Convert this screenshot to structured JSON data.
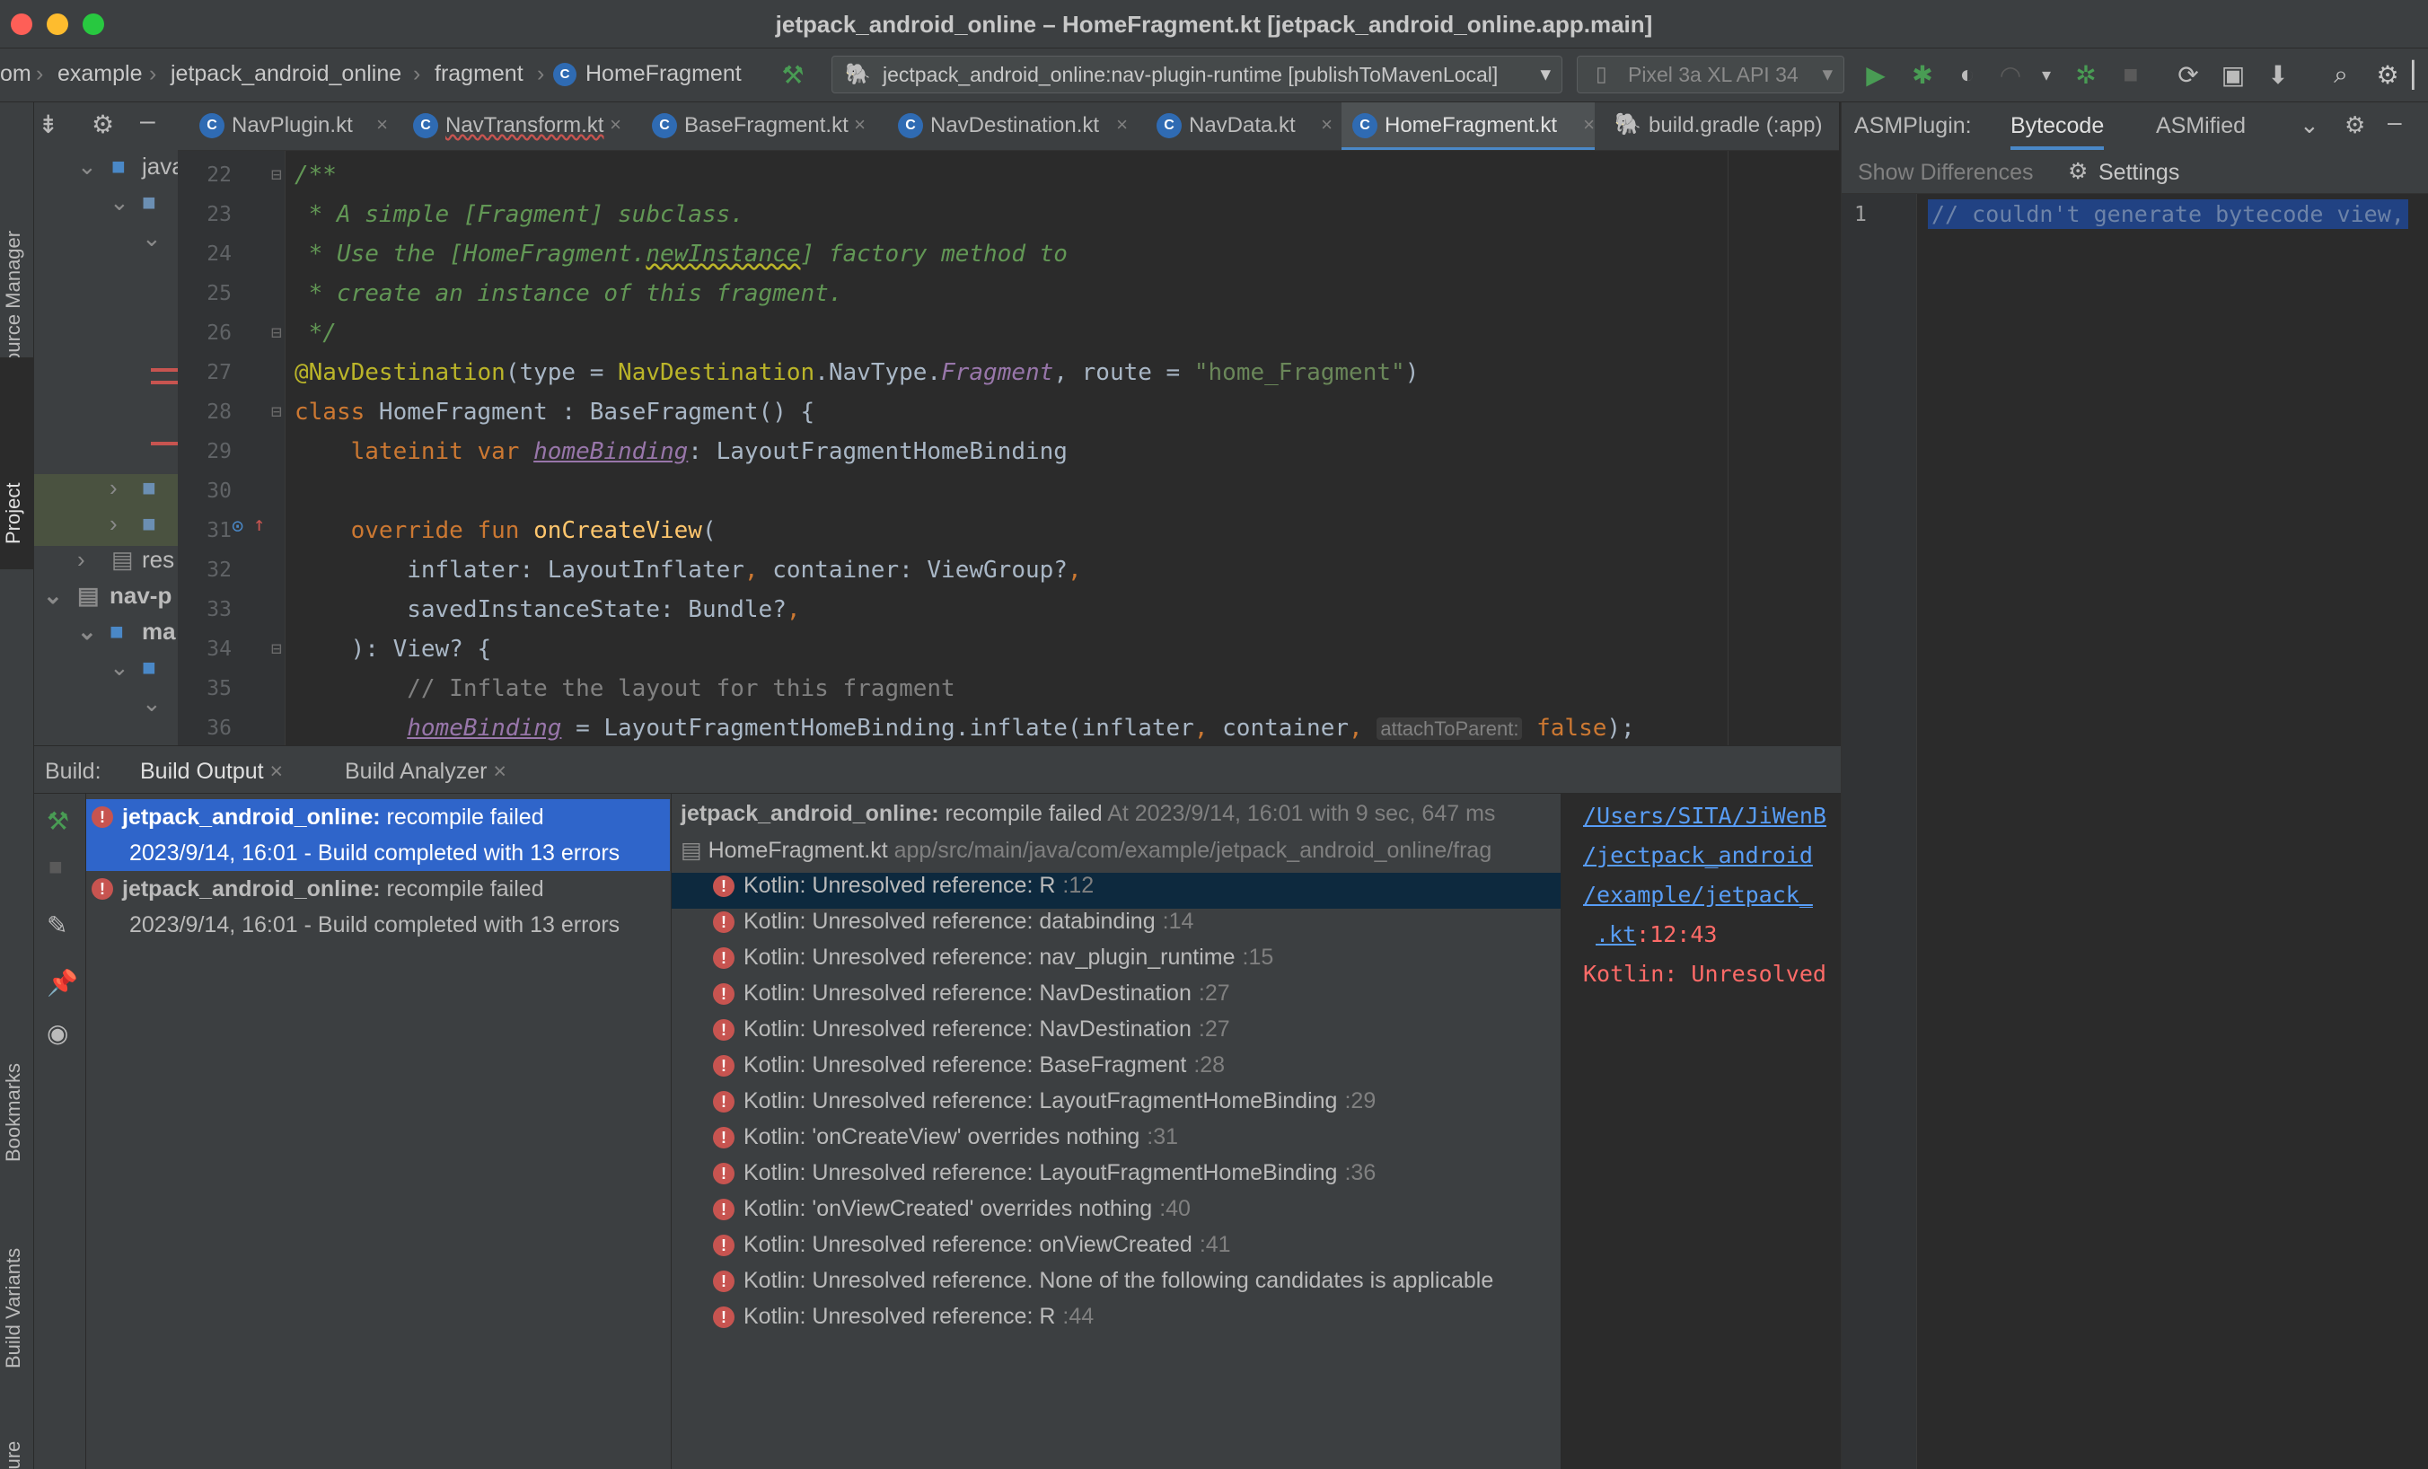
{
  "window": {
    "title": "jetpack_android_online – HomeFragment.kt [jetpack_android_online.app.main]"
  },
  "breadcrumb": [
    "om",
    "example",
    "jetpack_android_online",
    "fragment",
    "HomeFragment"
  ],
  "toolbar": {
    "run_config": "jectpack_android_online:nav-plugin-runtime [publishToMavenLocal]",
    "device": "Pixel 3a XL API 34"
  },
  "left_stripe": {
    "resource_manager": "Resource Manager",
    "project": "Project",
    "bookmarks": "Bookmarks",
    "build_variants": "Build Variants",
    "structure": "Structure"
  },
  "project_tree": [
    {
      "label": "java"
    },
    {
      "label": "res"
    },
    {
      "label": "nav-p"
    },
    {
      "label": "ma"
    }
  ],
  "editor_tabs": [
    {
      "label": "NavPlugin.kt",
      "active": false
    },
    {
      "label": "NavTransform.kt",
      "active": false
    },
    {
      "label": "BaseFragment.kt",
      "active": false
    },
    {
      "label": "NavDestination.kt",
      "active": false
    },
    {
      "label": "NavData.kt",
      "active": false
    },
    {
      "label": "HomeFragment.kt",
      "active": true
    },
    {
      "label": "build.gradle (:app)",
      "active": false
    }
  ],
  "line_numbers": [
    "22",
    "23",
    "24",
    "25",
    "26",
    "27",
    "28",
    "29",
    "30",
    "31",
    "32",
    "33",
    "34",
    "35",
    "36"
  ],
  "code": {
    "l22": "/**",
    "l23": " * A simple [Fragment] subclass.",
    "l24a": " * Use the [HomeFragment.",
    "l24b": "newInstance",
    "l24c": "] factory method to",
    "l25": " * create an instance of this fragment.",
    "l26": " */",
    "l27a": "@NavDestination",
    "l27b": "(type = ",
    "l27c": "NavDestination",
    "l27d": ".NavType.",
    "l27e": "Fragment",
    "l27f": ", route = ",
    "l27g": "\"home_Fragment\"",
    "l27h": ")",
    "l28a": "class",
    "l28b": " HomeFragment : BaseFragment() {",
    "l29a": "    lateinit var ",
    "l29b": "homeBinding",
    "l29c": ": LayoutFragmentHomeBinding",
    "l31a": "    override fun ",
    "l31b": "onCreateView",
    "l31c": "(",
    "l32a": "        inflater: LayoutInflater",
    "l32b": ", ",
    "l32c": "container: ViewGroup?",
    "l32d": ",",
    "l33a": "        savedInstanceState: Bundle?",
    "l33b": ",",
    "l34": "    ): View? {",
    "l35": "        // Inflate the layout for this fragment",
    "l36a": "        ",
    "l36b": "homeBinding",
    "l36c": " = LayoutFragmentHomeBinding.inflate(inflater",
    "l36d": ", ",
    "l36e": "container",
    "l36f": ",",
    "l36hint": "attachToParent:",
    "l36g": "false",
    "l36h": ");"
  },
  "asm": {
    "plugin_label": "ASMPlugin:",
    "tab_bytecode": "Bytecode",
    "tab_asmified": "ASMified",
    "show_differences": "Show Differences",
    "settings": "Settings",
    "line1": "1",
    "line1_text": "// couldn't generate bytecode view,"
  },
  "build": {
    "label": "Build:",
    "tab_output": "Build Output",
    "tab_analyzer": "Build Analyzer",
    "runs": [
      {
        "title": "jetpack_android_online:",
        "status": "recompile failed",
        "detail": "2023/9/14, 16:01 - Build completed with 13 errors",
        "selected": true
      },
      {
        "title": "jetpack_android_online:",
        "status": "recompile failed",
        "detail": "2023/9/14, 16:01 - Build completed with 13 errors",
        "selected": false
      }
    ],
    "tree_header": {
      "title": "jetpack_android_online:",
      "status": "recompile failed",
      "meta": "At 2023/9/14, 16:01 with 9 sec, 647 ms"
    },
    "file": {
      "name": "HomeFragment.kt",
      "path": "app/src/main/java/com/example/jetpack_android_online/frag"
    },
    "errors": [
      {
        "text": "Kotlin: Unresolved reference: R",
        "line": ":12"
      },
      {
        "text": "Kotlin: Unresolved reference: databinding",
        "line": ":14"
      },
      {
        "text": "Kotlin: Unresolved reference: nav_plugin_runtime",
        "line": ":15"
      },
      {
        "text": "Kotlin: Unresolved reference: NavDestination",
        "line": ":27"
      },
      {
        "text": "Kotlin: Unresolved reference: NavDestination",
        "line": ":27"
      },
      {
        "text": "Kotlin: Unresolved reference: BaseFragment",
        "line": ":28"
      },
      {
        "text": "Kotlin: Unresolved reference: LayoutFragmentHomeBinding",
        "line": ":29"
      },
      {
        "text": "Kotlin: 'onCreateView' overrides nothing",
        "line": ":31"
      },
      {
        "text": "Kotlin: Unresolved reference: LayoutFragmentHomeBinding",
        "line": ":36"
      },
      {
        "text": "Kotlin: 'onViewCreated' overrides nothing",
        "line": ":40"
      },
      {
        "text": "Kotlin: Unresolved reference: onViewCreated",
        "line": ":41"
      },
      {
        "text": "Kotlin: Unresolved reference. None of the following candidates is applicable",
        "line": ""
      },
      {
        "text": "Kotlin: Unresolved reference: R",
        "line": ":44"
      }
    ],
    "console": {
      "l1": "/Users/SITA/JiWenB",
      "l2": "/jectpack_android",
      "l3": "/example/jetpack_",
      "l4a": ".kt",
      "l4b": ":12:43",
      "l5": "Kotlin: Unresolved"
    }
  },
  "colors": {
    "accent": "#2f65ca",
    "error": "#c75450",
    "run_green": "#499c54"
  }
}
